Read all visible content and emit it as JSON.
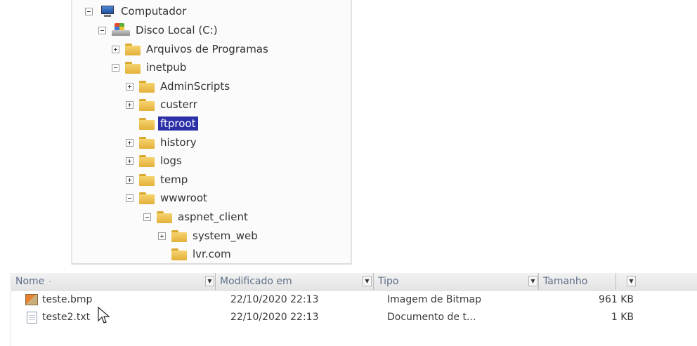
{
  "tree": {
    "computer": "Computador",
    "drive": "Disco Local (C:)",
    "items": [
      {
        "label": "Arquivos de Programas",
        "toggle": "plus"
      },
      {
        "label": "inetpub",
        "toggle": "minus"
      },
      {
        "label": "AdminScripts",
        "toggle": "plus"
      },
      {
        "label": "custerr",
        "toggle": "plus"
      },
      {
        "label": "ftproot",
        "toggle": "none",
        "selected": true
      },
      {
        "label": "history",
        "toggle": "plus"
      },
      {
        "label": "logs",
        "toggle": "plus"
      },
      {
        "label": "temp",
        "toggle": "plus"
      },
      {
        "label": "wwwroot",
        "toggle": "minus"
      },
      {
        "label": "aspnet_client",
        "toggle": "minus"
      },
      {
        "label": "system_web",
        "toggle": "plus"
      },
      {
        "label": "lvr.com",
        "toggle": "none"
      }
    ]
  },
  "file_list": {
    "columns": [
      {
        "label": "Nome",
        "sort": "-"
      },
      {
        "label": "Modificado em"
      },
      {
        "label": "Tipo"
      },
      {
        "label": "Tamanho"
      }
    ],
    "rows": [
      {
        "name": "teste.bmp",
        "modified": "22/10/2020 22:13",
        "type": "Imagem de Bitmap",
        "size": "961 KB",
        "icon": "bitmap-file-icon"
      },
      {
        "name": "teste2.txt",
        "modified": "22/10/2020 22:13",
        "type": "Documento de t...",
        "size": "1 KB",
        "icon": "text-file-icon"
      }
    ]
  },
  "colors": {
    "selection": "#2b2fa8",
    "header_text": "#5e6f88"
  }
}
